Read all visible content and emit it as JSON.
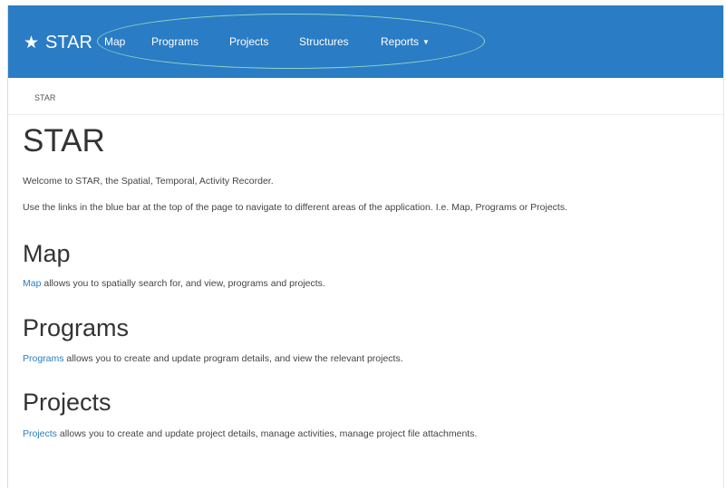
{
  "navbar": {
    "brand": "STAR",
    "items": [
      {
        "label": "Map"
      },
      {
        "label": "Programs"
      },
      {
        "label": "Projects"
      },
      {
        "label": "Structures"
      },
      {
        "label": "Reports"
      }
    ],
    "color": "#2a7cc4"
  },
  "breadcrumb": {
    "current": "STAR"
  },
  "main": {
    "title": "STAR",
    "intro": "Welcome to STAR, the Spatial, Temporal, Activity Recorder.",
    "instructions": "Use the links in the blue bar at the top of the page to navigate to different areas of the application. I.e. Map, Programs or Projects.",
    "sections": [
      {
        "heading": "Map",
        "link": "Map",
        "text": " allows you to spatially search for, and view, programs and projects."
      },
      {
        "heading": "Programs",
        "link": "Programs",
        "text": " allows you to create and update program details, and view the relevant projects."
      },
      {
        "heading": "Projects",
        "link": "Projects",
        "text": " allows you to create and update project details, manage activities, manage project file attachments."
      }
    ]
  },
  "icons": {
    "brand_icon": "star-icon",
    "dropdown_icon": "caret-down-icon"
  }
}
